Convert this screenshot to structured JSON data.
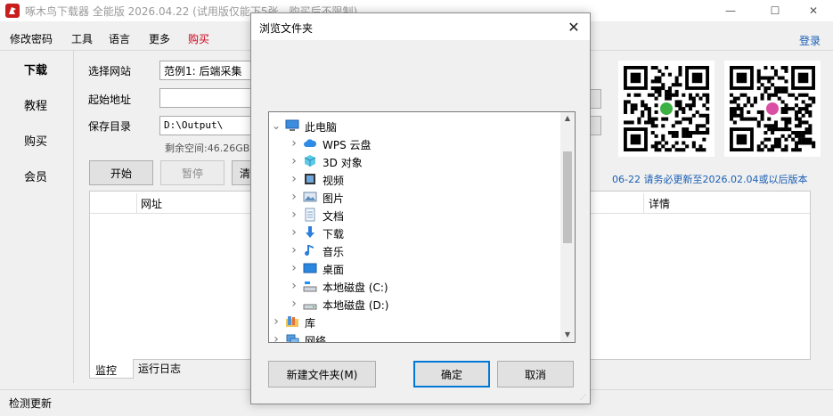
{
  "window": {
    "title": "啄木鸟下载器 全能版 2026.04.22 (试用版仅能下5张，购买后不限制)",
    "controls": {
      "minimize": "—",
      "maximize": "☐",
      "close": "✕"
    }
  },
  "menu": {
    "items": [
      "修改密码",
      "工具",
      "语言",
      "更多",
      "购买"
    ],
    "buy_color": "#d0021b",
    "login": "登录"
  },
  "nav": {
    "items": [
      "下载",
      "教程",
      "购买",
      "会员"
    ]
  },
  "form": {
    "site_label": "选择网站",
    "site_value": "范例1: 后端采集",
    "start_label": "起始地址",
    "start_value": "",
    "save_label": "保存目录",
    "save_value": "D:\\Output\\",
    "free_space": "剩余空间:46.26GB",
    "start_button": "开始",
    "pause_button": "暂停",
    "clear_button": "清"
  },
  "table": {
    "columns": [
      "网址",
      "详情"
    ]
  },
  "bottom_tabs": [
    "监控",
    "运行日志"
  ],
  "status": {
    "text": "检测更新"
  },
  "notice": "06-22 请务必更新至2026.02.04或以后版本",
  "dialog": {
    "title": "浏览文件夹",
    "tree": [
      {
        "label": "此电脑",
        "icon": "computer-icon",
        "expanded": true,
        "level": 0
      },
      {
        "label": "WPS 云盘",
        "icon": "cloud-icon",
        "level": 1
      },
      {
        "label": "3D 对象",
        "icon": "cube-icon",
        "level": 1
      },
      {
        "label": "视频",
        "icon": "video-icon",
        "level": 1
      },
      {
        "label": "图片",
        "icon": "picture-icon",
        "level": 1
      },
      {
        "label": "文档",
        "icon": "document-icon",
        "level": 1
      },
      {
        "label": "下载",
        "icon": "download-arrow-icon",
        "level": 1
      },
      {
        "label": "音乐",
        "icon": "music-icon",
        "level": 1
      },
      {
        "label": "桌面",
        "icon": "desktop-icon",
        "level": 1
      },
      {
        "label": "本地磁盘 (C:)",
        "icon": "drive-c-icon",
        "level": 1
      },
      {
        "label": "本地磁盘 (D:)",
        "icon": "drive-icon",
        "level": 1
      },
      {
        "label": "库",
        "icon": "library-icon",
        "level": 0
      },
      {
        "label": "网络",
        "icon": "network-icon",
        "level": 0
      }
    ],
    "new_folder_button": "新建文件夹(M)",
    "ok_button": "确定",
    "cancel_button": "取消"
  },
  "colors": {
    "accent": "#0078d7",
    "link": "#1a5fb4"
  }
}
